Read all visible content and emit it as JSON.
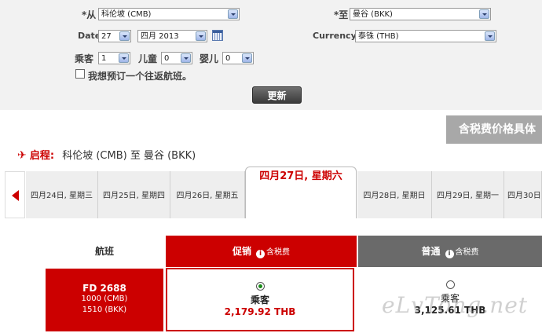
{
  "search": {
    "from_label": "*从",
    "from_value": "科伦坡 (CMB)",
    "to_label": "*至",
    "to_value": "曼谷 (BKK)",
    "date_label": "Date",
    "day_value": "27",
    "month_value": "四月 2013",
    "currency_label": "Currency",
    "currency_value": "泰铢 (THB)",
    "adult_label": "乘客",
    "adult_value": "1",
    "child_label": "儿童",
    "child_value": "0",
    "infant_label": "婴儿",
    "infant_value": "0",
    "return_label": "我想预订一个往返航班。",
    "update_label": "更新"
  },
  "banner": {
    "text": "含税费价格具体"
  },
  "route": {
    "label": "启程:",
    "text": "科伦坡 (CMB)  至  曼谷 (BKK)"
  },
  "dates": [
    {
      "label": "四月24日, 星期三"
    },
    {
      "label": "四月25日, 星期四"
    },
    {
      "label": "四月26日, 星期五"
    },
    {
      "label": "四月27日, 星期六"
    },
    {
      "label": "四月28日, 星期日"
    },
    {
      "label": "四月29日, 星期一"
    },
    {
      "label": "四月30日"
    }
  ],
  "table": {
    "flight_header": "航班",
    "promo_header": "促销",
    "regular_header": "普通",
    "tax_note": "含税费",
    "flight_no": "FD 2688",
    "dep": "1000 (CMB)",
    "arr": "1510 (BKK)",
    "pax_label": "乘客",
    "promo_price": "2,179.92 THB",
    "regular_price": "3,125.61 THB"
  },
  "watermark": "eLvTong.net",
  "colors": {
    "accent": "#cc0000",
    "regular": "#6a6a6a"
  }
}
